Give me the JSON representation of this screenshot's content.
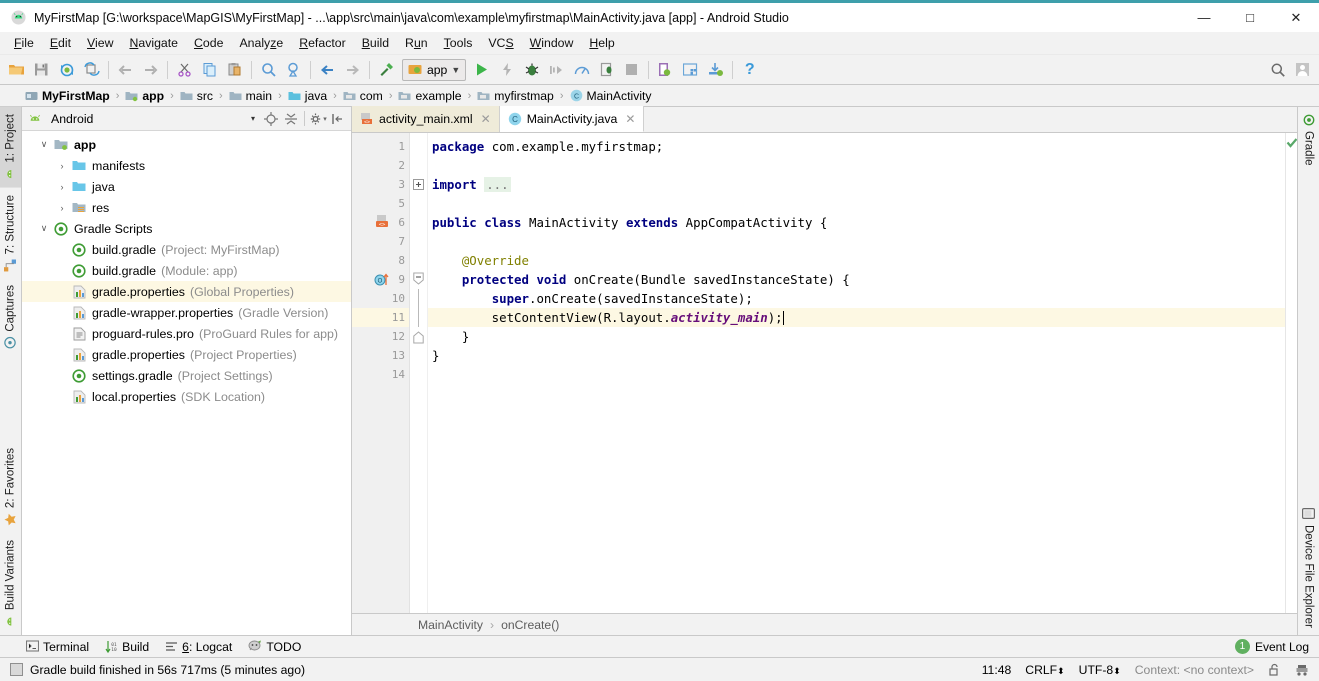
{
  "window": {
    "title": "MyFirstMap [G:\\workspace\\MapGIS\\MyFirstMap] - ...\\app\\src\\main\\java\\com\\example\\myfirstmap\\MainActivity.java [app] - Android Studio",
    "app_icon": "android-icon",
    "minimize_label": "—",
    "maximize_label": "□",
    "close_label": "✕",
    "accent_color": "#3e9fab"
  },
  "menubar": {
    "items": [
      {
        "label": "File",
        "mnemonic": "F"
      },
      {
        "label": "Edit",
        "mnemonic": "E"
      },
      {
        "label": "View",
        "mnemonic": "V"
      },
      {
        "label": "Navigate",
        "mnemonic": "N"
      },
      {
        "label": "Code",
        "mnemonic": "C"
      },
      {
        "label": "Analyze",
        "mnemonic": "z"
      },
      {
        "label": "Refactor",
        "mnemonic": "R"
      },
      {
        "label": "Build",
        "mnemonic": "B"
      },
      {
        "label": "Run",
        "mnemonic": "u"
      },
      {
        "label": "Tools",
        "mnemonic": "T"
      },
      {
        "label": "VCS",
        "mnemonic": "S"
      },
      {
        "label": "Window",
        "mnemonic": "W"
      },
      {
        "label": "Help",
        "mnemonic": "H"
      }
    ]
  },
  "toolbar": {
    "icons": [
      "open-folder-icon",
      "save-all-icon",
      "sync-project-icon",
      "reload-from-disk-icon",
      "undo-icon",
      "redo-icon",
      "cut-icon",
      "copy-icon",
      "paste-icon",
      "find-icon",
      "replace-icon",
      "back-icon",
      "forward-icon",
      "build-hammer-icon"
    ],
    "run_config": {
      "label": "app",
      "icon": "android-module-icon",
      "caret": "⌄"
    },
    "run_icons": [
      "run-icon",
      "apply-changes-icon",
      "debug-icon",
      "run-step-icon",
      "profiler-icon",
      "attach-debugger-icon",
      "stop-icon",
      "sdk-manager-icon",
      "avd-manager-icon",
      "sync-gradle-icon",
      "help-icon"
    ],
    "right_icons": [
      "search-everywhere-icon",
      "user-account-icon"
    ]
  },
  "breadcrumb": {
    "items": [
      {
        "label": "MyFirstMap",
        "icon": "project-icon",
        "bold": true
      },
      {
        "label": "app",
        "icon": "module-icon",
        "bold": true
      },
      {
        "label": "src",
        "icon": "folder-icon",
        "bold": false
      },
      {
        "label": "main",
        "icon": "folder-icon",
        "bold": false
      },
      {
        "label": "java",
        "icon": "source-folder-icon",
        "bold": false
      },
      {
        "label": "com",
        "icon": "package-icon",
        "bold": false
      },
      {
        "label": "example",
        "icon": "package-icon",
        "bold": false
      },
      {
        "label": "myfirstmap",
        "icon": "package-icon",
        "bold": false
      },
      {
        "label": "MainActivity",
        "icon": "class-icon",
        "bold": false
      }
    ],
    "separator": "›"
  },
  "left_strip": {
    "top_tabs": [
      {
        "label": "1: Project",
        "mnemonic": "1",
        "icon": "android-icon",
        "active": true
      },
      {
        "label": "7: Structure",
        "mnemonic": "7",
        "icon": "structure-icon",
        "active": false
      },
      {
        "label": "Captures",
        "mnemonic": "",
        "icon": "captures-icon",
        "active": false
      }
    ],
    "bottom_tabs": [
      {
        "label": "2: Favorites",
        "mnemonic": "2",
        "icon": "star-icon",
        "active": false
      },
      {
        "label": "Build Variants",
        "mnemonic": "",
        "icon": "android-icon",
        "active": false
      }
    ]
  },
  "right_strip": {
    "top_tabs": [
      {
        "label": "Gradle",
        "icon": "gradle-icon"
      }
    ],
    "bottom_tabs": [
      {
        "label": "Device File Explorer",
        "icon": "device-icon"
      }
    ]
  },
  "project_panel": {
    "header": {
      "title": "Android",
      "icon": "android-icon",
      "caret": "▾",
      "actions": [
        "locate-icon",
        "collapse-all-icon",
        "settings-gear-icon",
        "hide-panel-icon"
      ]
    },
    "tree": [
      {
        "indent": 0,
        "arrow": "∨",
        "icon": "module-icon",
        "label": "app",
        "bold": true,
        "note": "",
        "selected": false
      },
      {
        "indent": 1,
        "arrow": "›",
        "icon": "folder-icon",
        "label": "manifests",
        "bold": false,
        "note": "",
        "selected": false
      },
      {
        "indent": 1,
        "arrow": "›",
        "icon": "folder-icon",
        "label": "java",
        "bold": false,
        "note": "",
        "selected": false
      },
      {
        "indent": 1,
        "arrow": "›",
        "icon": "res-folder-icon",
        "label": "res",
        "bold": false,
        "note": "",
        "selected": false
      },
      {
        "indent": 0,
        "arrow": "∨",
        "icon": "gradle-icon",
        "label": "Gradle Scripts",
        "bold": false,
        "note": "",
        "selected": false
      },
      {
        "indent": 1,
        "arrow": "",
        "icon": "gradle-icon",
        "label": "build.gradle",
        "bold": false,
        "note": "(Project: MyFirstMap)",
        "selected": false
      },
      {
        "indent": 1,
        "arrow": "",
        "icon": "gradle-icon",
        "label": "build.gradle",
        "bold": false,
        "note": "(Module: app)",
        "selected": false
      },
      {
        "indent": 1,
        "arrow": "",
        "icon": "properties-icon",
        "label": "gradle.properties",
        "bold": false,
        "note": "(Global Properties)",
        "selected": true
      },
      {
        "indent": 1,
        "arrow": "",
        "icon": "properties-icon",
        "label": "gradle-wrapper.properties",
        "bold": false,
        "note": "(Gradle Version)",
        "selected": false
      },
      {
        "indent": 1,
        "arrow": "",
        "icon": "text-file-icon",
        "label": "proguard-rules.pro",
        "bold": false,
        "note": "(ProGuard Rules for app)",
        "selected": false
      },
      {
        "indent": 1,
        "arrow": "",
        "icon": "properties-icon",
        "label": "gradle.properties",
        "bold": false,
        "note": "(Project Properties)",
        "selected": false
      },
      {
        "indent": 1,
        "arrow": "",
        "icon": "gradle-icon",
        "label": "settings.gradle",
        "bold": false,
        "note": "(Project Settings)",
        "selected": false
      },
      {
        "indent": 1,
        "arrow": "",
        "icon": "properties-icon",
        "label": "local.properties",
        "bold": false,
        "note": "(SDK Location)",
        "selected": false
      }
    ]
  },
  "editor": {
    "tabs": [
      {
        "label": "activity_main.xml",
        "icon": "xml-layout-icon",
        "active": false,
        "close": "✕"
      },
      {
        "label": "MainActivity.java",
        "icon": "java-class-icon",
        "active": true,
        "close": "✕"
      }
    ],
    "lines": [
      {
        "n": "1",
        "highlight": false,
        "gutter_icon": "",
        "fold": "",
        "tokens": [
          {
            "t": "package ",
            "c": "kw"
          },
          {
            "t": "com.example.myfirstmap;",
            "c": "plain"
          }
        ]
      },
      {
        "n": "2",
        "highlight": false,
        "gutter_icon": "",
        "fold": "",
        "tokens": []
      },
      {
        "n": "3",
        "highlight": false,
        "gutter_icon": "",
        "fold": "plus",
        "tokens": [
          {
            "t": "import ",
            "c": "kw"
          },
          {
            "t": "...",
            "c": "fold"
          }
        ]
      },
      {
        "n": "5",
        "highlight": false,
        "gutter_icon": "",
        "fold": "",
        "tokens": []
      },
      {
        "n": "6",
        "highlight": false,
        "gutter_icon": "layout-relation-icon",
        "fold": "",
        "tokens": [
          {
            "t": "public class ",
            "c": "kw"
          },
          {
            "t": "MainActivity ",
            "c": "plain"
          },
          {
            "t": "extends ",
            "c": "kw"
          },
          {
            "t": "AppCompatActivity {",
            "c": "plain"
          }
        ]
      },
      {
        "n": "7",
        "highlight": false,
        "gutter_icon": "",
        "fold": "",
        "tokens": []
      },
      {
        "n": "8",
        "highlight": false,
        "gutter_icon": "",
        "fold": "",
        "tokens": [
          {
            "t": "    @Override",
            "c": "ann"
          }
        ]
      },
      {
        "n": "9",
        "highlight": false,
        "gutter_icon": "override-method-icon",
        "fold": "minus-top",
        "tokens": [
          {
            "t": "    ",
            "c": "plain"
          },
          {
            "t": "protected void ",
            "c": "kw"
          },
          {
            "t": "onCreate(Bundle savedInstanceState) {",
            "c": "plain"
          }
        ]
      },
      {
        "n": "10",
        "highlight": false,
        "gutter_icon": "",
        "fold": "bar",
        "tokens": [
          {
            "t": "        ",
            "c": "plain"
          },
          {
            "t": "super",
            "c": "kw"
          },
          {
            "t": ".onCreate(savedInstanceState);",
            "c": "plain"
          }
        ]
      },
      {
        "n": "11",
        "highlight": true,
        "gutter_icon": "",
        "fold": "bar",
        "tokens": [
          {
            "t": "        setContentView(R.layout.",
            "c": "plain"
          },
          {
            "t": "activity_main",
            "c": "field"
          },
          {
            "t": ");",
            "c": "plain"
          },
          {
            "t": "|",
            "c": "caret"
          }
        ]
      },
      {
        "n": "12",
        "highlight": false,
        "gutter_icon": "",
        "fold": "minus-bot",
        "tokens": [
          {
            "t": "    }",
            "c": "plain"
          }
        ]
      },
      {
        "n": "13",
        "highlight": false,
        "gutter_icon": "",
        "fold": "",
        "tokens": [
          {
            "t": "}",
            "c": "plain"
          }
        ]
      },
      {
        "n": "14",
        "highlight": false,
        "gutter_icon": "",
        "fold": "",
        "tokens": []
      }
    ],
    "inspection_status": "ok-check-icon",
    "footer_breadcrumb": [
      "MainActivity",
      "onCreate()"
    ],
    "footer_separator": "›"
  },
  "bottom_tool_window_bar": {
    "items": [
      {
        "label": "Terminal",
        "icon": "terminal-icon",
        "mnemonic": ""
      },
      {
        "label": "Build",
        "icon": "build-icon",
        "mnemonic": ""
      },
      {
        "label": "6: Logcat",
        "icon": "logcat-icon",
        "mnemonic": "6"
      },
      {
        "label": "TODO",
        "icon": "todo-icon",
        "mnemonic": ""
      }
    ],
    "event_log": {
      "label": "Event Log",
      "count": "1",
      "badge_color": "#60b060"
    }
  },
  "status_bar": {
    "message": "Gradle build finished in 56s 717ms (5 minutes ago)",
    "icon": "memory-indicator-icon",
    "caret_position": "11:48",
    "line_separator": "CRLF",
    "encoding": "UTF-8",
    "context_label": "Context:",
    "context_value": "<no context>",
    "lock_icon": "unlock-icon",
    "inspector_icon": "hector-inspector-icon"
  }
}
